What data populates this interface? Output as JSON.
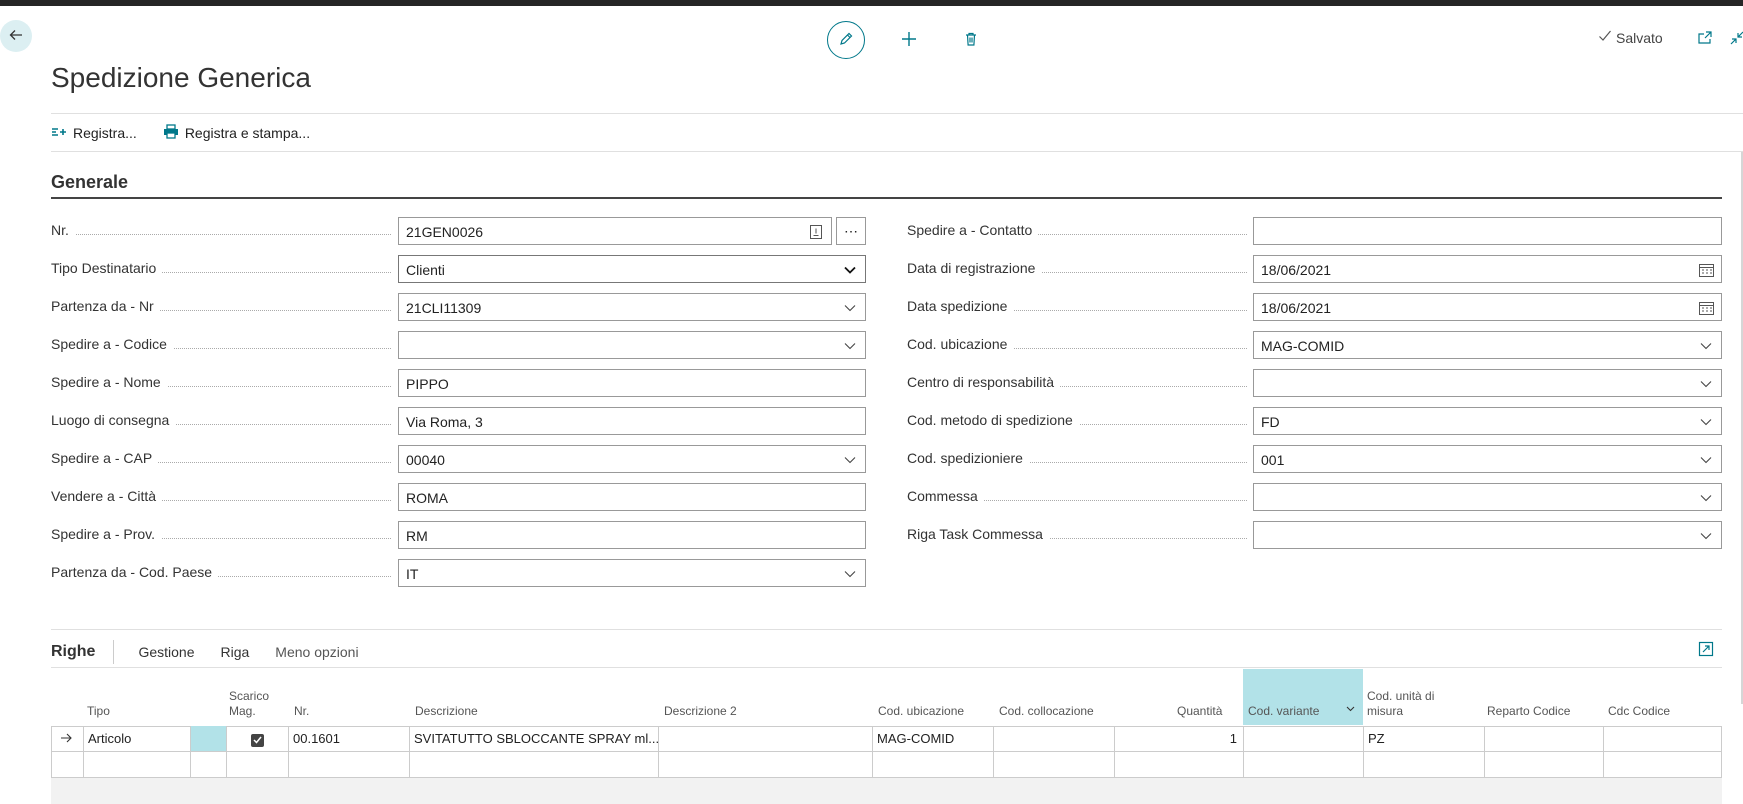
{
  "page": {
    "title": "Spedizione Generica"
  },
  "header": {
    "status_label": "Salvato"
  },
  "action_bar": {
    "actions": [
      {
        "label": "Registra...",
        "icon": "post-icon"
      },
      {
        "label": "Registra e stampa...",
        "icon": "print-icon"
      }
    ]
  },
  "general": {
    "section_title": "Generale",
    "left_fields": [
      {
        "label": "Nr.",
        "value": "21GEN0026"
      },
      {
        "label": "Tipo Destinatario",
        "value": "Clienti"
      },
      {
        "label": "Partenza da - Nr",
        "value": "21CLI11309"
      },
      {
        "label": "Spedire a - Codice",
        "value": ""
      },
      {
        "label": "Spedire a - Nome",
        "value": "PIPPO"
      },
      {
        "label": "Luogo di consegna",
        "value": "Via Roma, 3"
      },
      {
        "label": "Spedire a - CAP",
        "value": "00040"
      },
      {
        "label": "Vendere a - Città",
        "value": "ROMA"
      },
      {
        "label": "Spedire a - Prov.",
        "value": "RM"
      },
      {
        "label": "Partenza da - Cod. Paese",
        "value": "IT"
      }
    ],
    "right_fields": [
      {
        "label": "Spedire a - Contatto",
        "value": ""
      },
      {
        "label": "Data di registrazione",
        "value": "18/06/2021"
      },
      {
        "label": "Data spedizione",
        "value": "18/06/2021"
      },
      {
        "label": "Cod. ubicazione",
        "value": "MAG-COMID"
      },
      {
        "label": "Centro di responsabilità",
        "value": ""
      },
      {
        "label": "Cod. metodo di spedizione",
        "value": "FD"
      },
      {
        "label": "Cod. spedizioniere",
        "value": "001"
      },
      {
        "label": "Commessa",
        "value": ""
      },
      {
        "label": "Riga Task Commessa",
        "value": ""
      }
    ],
    "more_button": "⋯"
  },
  "lines": {
    "title": "Righe",
    "menu": [
      "Gestione",
      "Riga",
      "Meno opzioni"
    ],
    "columns": {
      "tipo": "Tipo",
      "scarico_1": "Scarico",
      "scarico_2": "Mag.",
      "nr": "Nr.",
      "descrizione": "Descrizione",
      "descrizione2": "Descrizione 2",
      "cod_ubicazione": "Cod. ubicazione",
      "cod_collocazione": "Cod. collocazione",
      "quantita": "Quantità",
      "cod_variante": "Cod. variante",
      "um_1": "Cod. unità di",
      "um_2": "misura",
      "reparto": "Reparto Codice",
      "cdc": "Cdc Codice"
    },
    "rows": [
      {
        "tipo": "Articolo",
        "scarico": true,
        "nr": "00.1601",
        "descrizione": "SVITATUTTO SBLOCCANTE SPRAY ml....",
        "descrizione2": "",
        "cod_ubicazione": "MAG-COMID",
        "cod_collocazione": "",
        "quantita": "1",
        "cod_variante": "",
        "um": "PZ",
        "reparto": "",
        "cdc": ""
      }
    ]
  },
  "colors": {
    "accent": "#00788a",
    "selected_column": "#b2e2e8"
  }
}
